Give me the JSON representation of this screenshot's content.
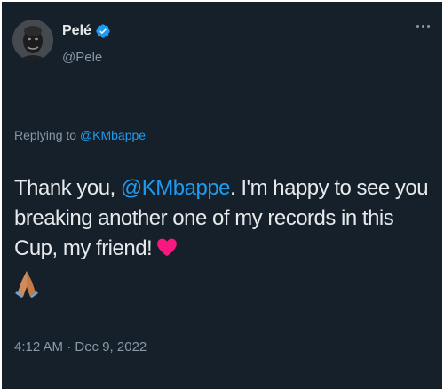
{
  "author": {
    "display_name": "Pelé",
    "handle": "@Pele",
    "verified": true
  },
  "reply": {
    "prefix": "Replying to",
    "mention": "@KMbappe"
  },
  "tweet": {
    "text_before": "Thank you, ",
    "mention": "@KMbappe",
    "text_after": ". I'm happy to see you breaking another one of my records in this Cup, my friend!",
    "emoji": [
      "heart-icon",
      "folded-hands-icon"
    ]
  },
  "timestamp": "4:12 AM · Dec 9, 2022",
  "colors": {
    "background": "#15202b",
    "text": "#e7e9ea",
    "secondary": "#8b98a5",
    "accent": "#1d9bf0",
    "heart": "#f91880"
  }
}
